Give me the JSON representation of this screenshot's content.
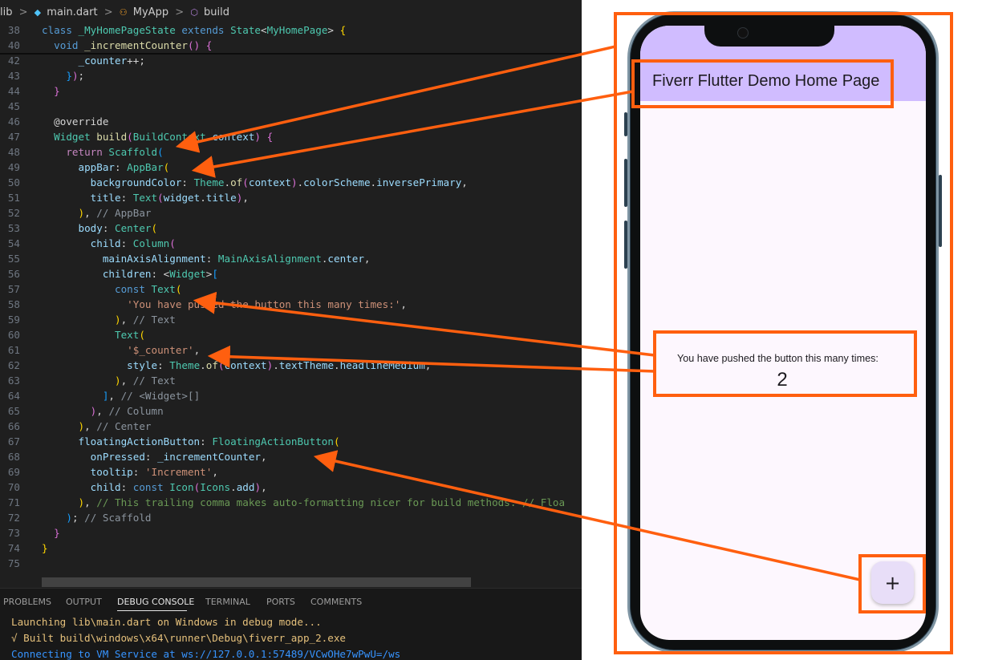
{
  "breadcrumb": {
    "root": "lib",
    "file": "main.dart",
    "class": "MyApp",
    "method": "build"
  },
  "code_lines": [
    {
      "n": "38",
      "parts": [
        [
          "k",
          "class "
        ],
        [
          "t",
          "_MyHomePageState "
        ],
        [
          "k",
          "extends "
        ],
        [
          "t",
          "State"
        ],
        [
          "d",
          "<"
        ],
        [
          "t",
          "MyHomePage"
        ],
        [
          "d",
          "> "
        ],
        [
          "br1",
          "{"
        ]
      ]
    },
    {
      "n": "40",
      "parts": [
        [
          "d",
          "  "
        ],
        [
          "k",
          "void "
        ],
        [
          "f",
          "_incrementCounter"
        ],
        [
          "br2",
          "()"
        ],
        [
          "d",
          " "
        ],
        [
          "br2",
          "{"
        ]
      ]
    },
    {
      "n": "42",
      "parts": [
        [
          "d",
          "      "
        ],
        [
          "v",
          "_counter"
        ],
        [
          "d",
          "++;"
        ]
      ]
    },
    {
      "n": "43",
      "parts": [
        [
          "d",
          "    "
        ],
        [
          "br3",
          "}"
        ],
        [
          "br2",
          ")"
        ],
        [
          "d",
          ";"
        ]
      ]
    },
    {
      "n": "44",
      "parts": [
        [
          "d",
          "  "
        ],
        [
          "br2",
          "}"
        ]
      ]
    },
    {
      "n": "45",
      "parts": []
    },
    {
      "n": "46",
      "parts": [
        [
          "d",
          "  "
        ],
        [
          "d",
          "@override"
        ]
      ]
    },
    {
      "n": "47",
      "parts": [
        [
          "d",
          "  "
        ],
        [
          "t",
          "Widget "
        ],
        [
          "f",
          "build"
        ],
        [
          "br2",
          "("
        ],
        [
          "t",
          "BuildContext "
        ],
        [
          "v",
          "context"
        ],
        [
          "br2",
          ")"
        ],
        [
          "d",
          " "
        ],
        [
          "br2",
          "{"
        ]
      ]
    },
    {
      "n": "48",
      "parts": [
        [
          "d",
          "    "
        ],
        [
          "kc",
          "return "
        ],
        [
          "t",
          "Scaffold"
        ],
        [
          "br3",
          "("
        ]
      ]
    },
    {
      "n": "49",
      "parts": [
        [
          "d",
          "      "
        ],
        [
          "v",
          "appBar"
        ],
        [
          "d",
          ": "
        ],
        [
          "t",
          "AppBar"
        ],
        [
          "br1",
          "("
        ]
      ]
    },
    {
      "n": "50",
      "parts": [
        [
          "d",
          "        "
        ],
        [
          "v",
          "backgroundColor"
        ],
        [
          "d",
          ": "
        ],
        [
          "t",
          "Theme"
        ],
        [
          "d",
          "."
        ],
        [
          "f",
          "of"
        ],
        [
          "br2",
          "("
        ],
        [
          "v",
          "context"
        ],
        [
          "br2",
          ")"
        ],
        [
          "d",
          "."
        ],
        [
          "v",
          "colorScheme"
        ],
        [
          "d",
          "."
        ],
        [
          "v",
          "inversePrimary"
        ],
        [
          "d",
          ","
        ]
      ]
    },
    {
      "n": "51",
      "parts": [
        [
          "d",
          "        "
        ],
        [
          "v",
          "title"
        ],
        [
          "d",
          ": "
        ],
        [
          "t",
          "Text"
        ],
        [
          "br2",
          "("
        ],
        [
          "v",
          "widget"
        ],
        [
          "d",
          "."
        ],
        [
          "v",
          "title"
        ],
        [
          "br2",
          ")"
        ],
        [
          "d",
          ","
        ]
      ]
    },
    {
      "n": "52",
      "parts": [
        [
          "d",
          "      "
        ],
        [
          "br1",
          ")"
        ],
        [
          "d",
          ", "
        ],
        [
          "g",
          "// AppBar"
        ]
      ]
    },
    {
      "n": "53",
      "parts": [
        [
          "d",
          "      "
        ],
        [
          "v",
          "body"
        ],
        [
          "d",
          ": "
        ],
        [
          "t",
          "Center"
        ],
        [
          "br1",
          "("
        ]
      ]
    },
    {
      "n": "54",
      "parts": [
        [
          "d",
          "        "
        ],
        [
          "v",
          "child"
        ],
        [
          "d",
          ": "
        ],
        [
          "t",
          "Column"
        ],
        [
          "br2",
          "("
        ]
      ]
    },
    {
      "n": "55",
      "parts": [
        [
          "d",
          "          "
        ],
        [
          "v",
          "mainAxisAlignment"
        ],
        [
          "d",
          ": "
        ],
        [
          "t",
          "MainAxisAlignment"
        ],
        [
          "d",
          "."
        ],
        [
          "v",
          "center"
        ],
        [
          "d",
          ","
        ]
      ]
    },
    {
      "n": "56",
      "parts": [
        [
          "d",
          "          "
        ],
        [
          "v",
          "children"
        ],
        [
          "d",
          ": <"
        ],
        [
          "t",
          "Widget"
        ],
        [
          "d",
          ">"
        ],
        [
          "br3",
          "["
        ]
      ]
    },
    {
      "n": "57",
      "parts": [
        [
          "d",
          "            "
        ],
        [
          "k",
          "const "
        ],
        [
          "t",
          "Text"
        ],
        [
          "br1",
          "("
        ]
      ]
    },
    {
      "n": "58",
      "parts": [
        [
          "d",
          "              "
        ],
        [
          "s",
          "'You have pushed the button this many times:'"
        ],
        [
          "d",
          ","
        ]
      ]
    },
    {
      "n": "59",
      "parts": [
        [
          "d",
          "            "
        ],
        [
          "br1",
          ")"
        ],
        [
          "d",
          ", "
        ],
        [
          "g",
          "// Text"
        ]
      ]
    },
    {
      "n": "60",
      "parts": [
        [
          "d",
          "            "
        ],
        [
          "t",
          "Text"
        ],
        [
          "br1",
          "("
        ]
      ]
    },
    {
      "n": "61",
      "parts": [
        [
          "d",
          "              "
        ],
        [
          "s",
          "'$_counter'"
        ],
        [
          "d",
          ","
        ]
      ]
    },
    {
      "n": "62",
      "parts": [
        [
          "d",
          "              "
        ],
        [
          "v",
          "style"
        ],
        [
          "d",
          ": "
        ],
        [
          "t",
          "Theme"
        ],
        [
          "d",
          "."
        ],
        [
          "f",
          "of"
        ],
        [
          "br2",
          "("
        ],
        [
          "v",
          "context"
        ],
        [
          "br2",
          ")"
        ],
        [
          "d",
          "."
        ],
        [
          "v",
          "textTheme"
        ],
        [
          "d",
          "."
        ],
        [
          "v",
          "headlineMedium"
        ],
        [
          "d",
          ","
        ]
      ]
    },
    {
      "n": "63",
      "parts": [
        [
          "d",
          "            "
        ],
        [
          "br1",
          ")"
        ],
        [
          "d",
          ", "
        ],
        [
          "g",
          "// Text"
        ]
      ]
    },
    {
      "n": "64",
      "parts": [
        [
          "d",
          "          "
        ],
        [
          "br3",
          "]"
        ],
        [
          "d",
          ", "
        ],
        [
          "g",
          "// <Widget>[]"
        ]
      ]
    },
    {
      "n": "65",
      "parts": [
        [
          "d",
          "        "
        ],
        [
          "br2",
          ")"
        ],
        [
          "d",
          ", "
        ],
        [
          "g",
          "// Column"
        ]
      ]
    },
    {
      "n": "66",
      "parts": [
        [
          "d",
          "      "
        ],
        [
          "br1",
          ")"
        ],
        [
          "d",
          ", "
        ],
        [
          "g",
          "// Center"
        ]
      ]
    },
    {
      "n": "67",
      "parts": [
        [
          "d",
          "      "
        ],
        [
          "v",
          "floatingActionButton"
        ],
        [
          "d",
          ": "
        ],
        [
          "t",
          "FloatingActionButton"
        ],
        [
          "br1",
          "("
        ]
      ]
    },
    {
      "n": "68",
      "parts": [
        [
          "d",
          "        "
        ],
        [
          "v",
          "onPressed"
        ],
        [
          "d",
          ": "
        ],
        [
          "v",
          "_incrementCounter"
        ],
        [
          "d",
          ","
        ]
      ]
    },
    {
      "n": "69",
      "parts": [
        [
          "d",
          "        "
        ],
        [
          "v",
          "tooltip"
        ],
        [
          "d",
          ": "
        ],
        [
          "s",
          "'Increment'"
        ],
        [
          "d",
          ","
        ]
      ]
    },
    {
      "n": "70",
      "parts": [
        [
          "d",
          "        "
        ],
        [
          "v",
          "child"
        ],
        [
          "d",
          ": "
        ],
        [
          "k",
          "const "
        ],
        [
          "t",
          "Icon"
        ],
        [
          "br2",
          "("
        ],
        [
          "t",
          "Icons"
        ],
        [
          "d",
          "."
        ],
        [
          "v",
          "add"
        ],
        [
          "br2",
          ")"
        ],
        [
          "d",
          ","
        ]
      ]
    },
    {
      "n": "71",
      "parts": [
        [
          "d",
          "      "
        ],
        [
          "br1",
          ")"
        ],
        [
          "d",
          ", "
        ],
        [
          "c",
          "// This trailing comma makes auto-formatting nicer for build methods. // Floa"
        ]
      ]
    },
    {
      "n": "72",
      "parts": [
        [
          "d",
          "    "
        ],
        [
          "br3",
          ")"
        ],
        [
          "d",
          "; "
        ],
        [
          "g",
          "// Scaffold"
        ]
      ]
    },
    {
      "n": "73",
      "parts": [
        [
          "d",
          "  "
        ],
        [
          "br2",
          "}"
        ]
      ]
    },
    {
      "n": "74",
      "parts": [
        [
          "br1",
          "}"
        ]
      ]
    },
    {
      "n": "75",
      "parts": []
    }
  ],
  "panel": {
    "tabs": [
      "PROBLEMS",
      "OUTPUT",
      "DEBUG CONSOLE",
      "TERMINAL",
      "PORTS",
      "COMMENTS"
    ],
    "active_tab": "DEBUG CONSOLE",
    "output": [
      {
        "text": "Launching lib\\main.dart on Windows in debug mode...",
        "color": "#e5c07b"
      },
      {
        "text": "√ Built build\\windows\\x64\\runner\\Debug\\fiverr_app_2.exe",
        "color": "#e5c07b"
      },
      {
        "text": "Connecting to VM Service at ws://127.0.0.1:57489/VCwOHe7wPwU=/ws",
        "color": "#3794ff"
      }
    ]
  },
  "app": {
    "title": "Fiverr Flutter Demo Home Page",
    "pushed_label": "You have pushed the button this many times:",
    "counter": "2",
    "fab_icon": "+",
    "appbar_color": "#d0bcff",
    "surface_color": "#fdf7fe",
    "fab_color": "#e8def8"
  },
  "annotation_color": "#ff5f0f"
}
